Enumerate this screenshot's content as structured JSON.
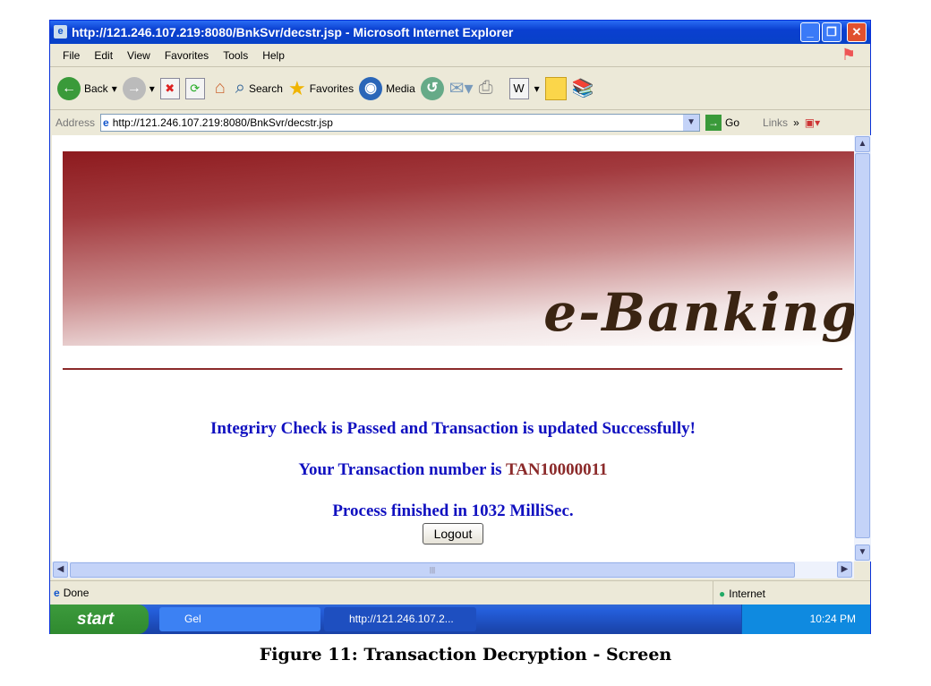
{
  "window": {
    "title": "http://121.246.107.219:8080/BnkSvr/decstr.jsp - Microsoft Internet Explorer"
  },
  "menu": [
    "File",
    "Edit",
    "View",
    "Favorites",
    "Tools",
    "Help"
  ],
  "toolbar": {
    "back": "Back",
    "search": "Search",
    "favorites": "Favorites",
    "media": "Media"
  },
  "address": {
    "label": "Address",
    "url": "http://121.246.107.219:8080/BnkSvr/decstr.jsp",
    "go": "Go",
    "links": "Links"
  },
  "page": {
    "logo": "e-Banking",
    "message": "Integriry Check is Passed and Transaction is updated Successfully!",
    "txn_prefix": "Your Transaction number is",
    "txn_number": "TAN10000011",
    "process": "Process finished in 1032 MilliSec.",
    "logout": "Logout"
  },
  "status": {
    "text": "Done",
    "zone": "Internet"
  },
  "taskbar": {
    "start": "start",
    "items": [
      "Gel",
      "http://121.246.107.2..."
    ],
    "clock": "10:24 PM"
  },
  "caption": "Figure 11: Transaction Decryption - Screen"
}
